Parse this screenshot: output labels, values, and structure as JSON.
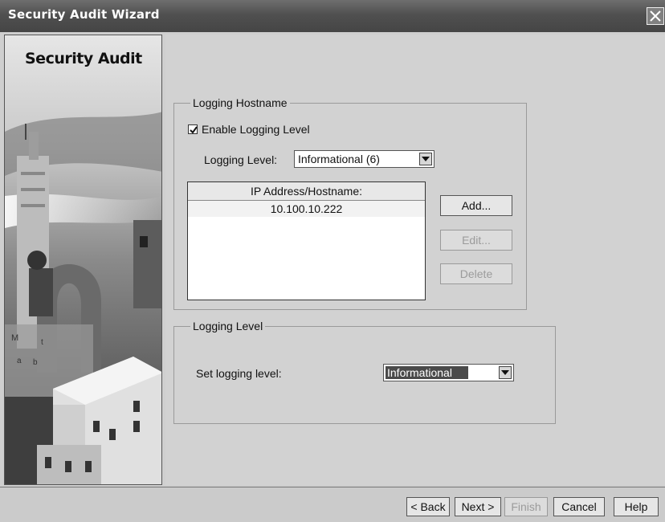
{
  "window": {
    "title": "Security Audit Wizard"
  },
  "left_panel": {
    "heading": "Security Audit"
  },
  "logging_hostname": {
    "legend": "Logging Hostname",
    "enable_label": "Enable Logging Level",
    "enable_checked": true,
    "level_label": "Logging Level:",
    "level_value": "Informational (6)",
    "table": {
      "header": "IP Address/Hostname:",
      "rows": [
        "10.100.10.222"
      ]
    },
    "buttons": {
      "add": "Add...",
      "edit": "Edit...",
      "delete": "Delete"
    }
  },
  "logging_level": {
    "legend": "Logging Level",
    "set_label": "Set logging level:",
    "set_value": "Informational"
  },
  "footer": {
    "back": "< Back",
    "next": "Next >",
    "finish": "Finish",
    "cancel": "Cancel",
    "help": "Help"
  },
  "icons": [
    "close-icon",
    "checkmark-icon",
    "dropdown-arrow-icon"
  ]
}
